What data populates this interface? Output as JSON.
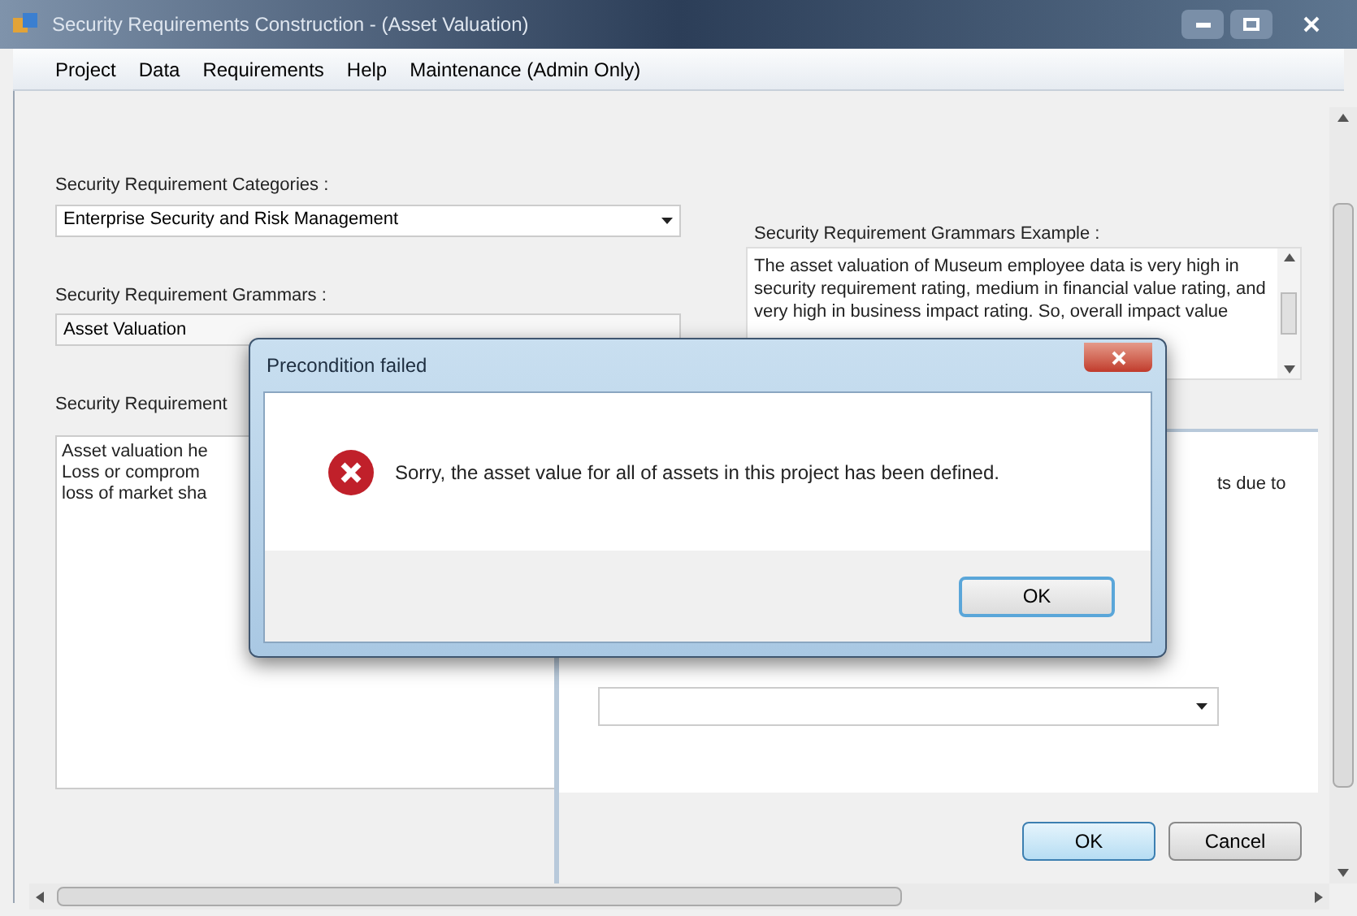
{
  "window": {
    "title": "Security Requirements Construction - (Asset Valuation)"
  },
  "menu": [
    "Project",
    "Data",
    "Requirements",
    "Help",
    "Maintenance (Admin Only)"
  ],
  "categories": {
    "label": "Security Requirement Categories :",
    "value": "Enterprise Security and Risk Management"
  },
  "grammars": {
    "label": "Security Requirement Grammars :",
    "value": "Asset Valuation"
  },
  "requirement": {
    "label": "Security Requirement",
    "lines": [
      "Asset valuation he",
      "Loss or comprom",
      "loss of market sha"
    ]
  },
  "example": {
    "label": "Security Requirement Grammars Example :",
    "text": "The asset valuation of Museum employee data is very high in security requirement rating, medium in financial value rating, and very high in business impact rating. So, overall impact value"
  },
  "detail": {
    "text": "ts due to"
  },
  "buttons": [
    "OK",
    "Cancel"
  ],
  "dialog": {
    "title": "Precondition failed",
    "message": "Sorry, the asset value for all of assets in this project has been defined.",
    "button": "OK"
  }
}
